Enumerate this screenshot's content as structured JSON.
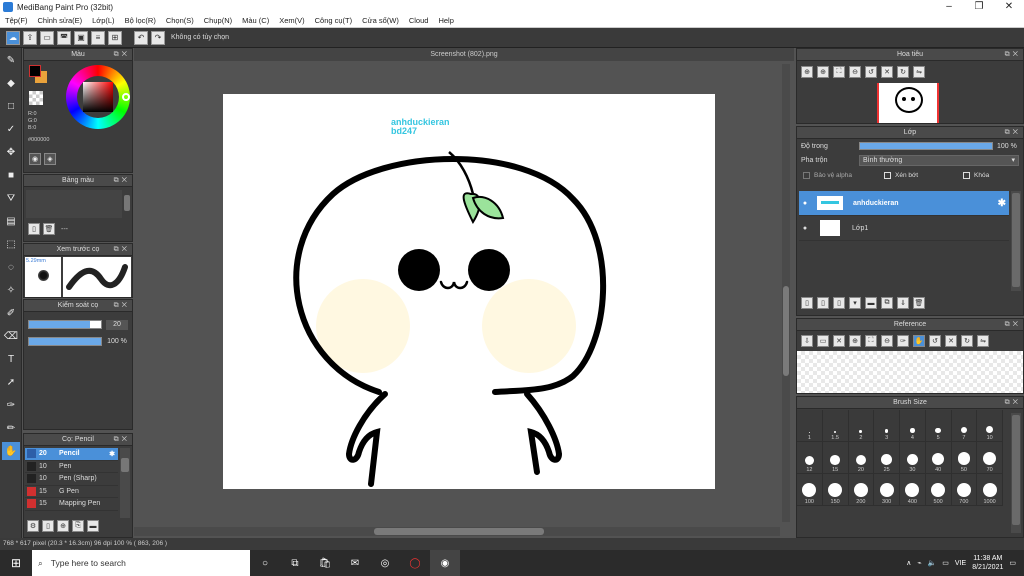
{
  "window": {
    "title": "MediBang Paint Pro (32bit)",
    "min": "–",
    "max": "❐",
    "close": "✕"
  },
  "menu": [
    "Tệp(F)",
    "Chỉnh sửa(E)",
    "Lớp(L)",
    "Bộ lọc(R)",
    "Chọn(S)",
    "Chụp(N)",
    "Màu (C)",
    "Xem(V)",
    "Công cụ(T)",
    "Cửa sổ(W)",
    "Cloud",
    "Help"
  ],
  "toolbar": {
    "selection_text": "Không có tùy chọn"
  },
  "color_panel": {
    "title": "Màu",
    "rgb": "R:0\nG:0\nB:0",
    "hex": "#000000",
    "fg_color": "#000000",
    "bg_color": "#ffffff"
  },
  "palette_panel": {
    "title": "Bảng màu",
    "delete_label": "---"
  },
  "brush_preview": {
    "title": "Xem trước cọ",
    "size_label": "5.29mm"
  },
  "brush_control": {
    "title": "Kiểm soát cọ",
    "size": "20",
    "opacity": "100 %",
    "size_fraction": 0.85,
    "opacity_fraction": 1.0
  },
  "brush_list": {
    "title": "Cọ: Pencil",
    "items": [
      {
        "size": "20",
        "name": "Pencil",
        "color": "#2d5fa8",
        "selected": true
      },
      {
        "size": "10",
        "name": "Pen",
        "color": "#222222"
      },
      {
        "size": "10",
        "name": "Pen (Sharp)",
        "color": "#222222"
      },
      {
        "size": "15",
        "name": "G Pen",
        "color": "#d03030"
      },
      {
        "size": "15",
        "name": "Mapping Pen",
        "color": "#d03030"
      }
    ]
  },
  "canvas": {
    "doc_title": "Screenshot (802).png",
    "text_line1": "anhduckieran",
    "text_line2": "bd247"
  },
  "navigator": {
    "title": "Hoa tiêu"
  },
  "layers": {
    "title": "Lớp",
    "opacity_label": "Độ trong",
    "opacity_value": "100 %",
    "blend_label": "Pha trộn",
    "blend_value": "Bình thường",
    "protect_alpha": "Bảo vệ alpha",
    "clipping": "Xén bớt",
    "lock": "Khóa",
    "items": [
      {
        "name": "anhduckieran",
        "selected": true
      },
      {
        "name": "Lớp1",
        "selected": false
      }
    ]
  },
  "reference": {
    "title": "Reference"
  },
  "brush_size": {
    "title": "Brush Size",
    "sizes": [
      "1",
      "1.5",
      "2",
      "3",
      "4",
      "5",
      "7",
      "10",
      "12",
      "15",
      "20",
      "25",
      "30",
      "40",
      "50",
      "70",
      "100",
      "150",
      "200",
      "300",
      "400",
      "500",
      "700",
      "1000"
    ]
  },
  "status": {
    "text": "768 * 617 pixel   (20.3 * 16.3cm)   96 dpi   100 %   ( 863, 206 )"
  },
  "taskbar": {
    "search_placeholder": "Type here to search",
    "time": "11:38 AM",
    "date": "8/21/2021",
    "lang": "VIE"
  }
}
